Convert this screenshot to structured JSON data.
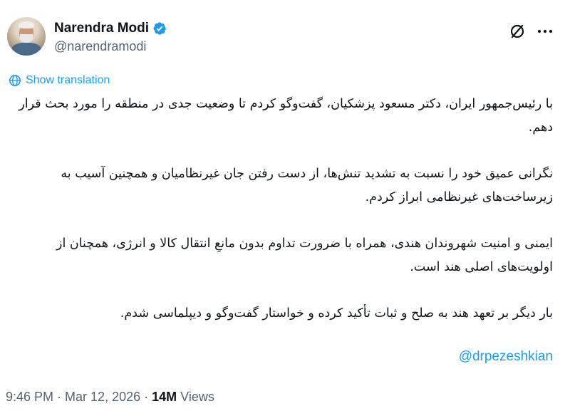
{
  "author": {
    "display_name": "Narendra Modi",
    "handle": "@narendramodi",
    "verified": true
  },
  "header_icons": {
    "grok": "grok-icon",
    "more": "more-icon"
  },
  "translation": {
    "label": "Show translation",
    "icon": "translate-icon"
  },
  "tweet": {
    "paragraphs": [
      "با رئیس‌جمهور ایران، دکتر مسعود پزشکیان، گفت‌وگو کردم تا وضعیت جدی در منطقه را مورد بحث قرار دهم.",
      "نگرانی عمیق خود را نسبت به تشدید تنش‌ها، از دست رفتن جان غیرنظامیان و همچنین آسیب به زیرساخت‌های غیرنظامی ابراز کردم.",
      "ایمنی و امنیت شهروندان هندی، همراه با ضرورت تداوم بدون مانعِ انتقال کالا و انرژی، همچنان از اولویت‌های اصلی هند است.",
      "بار دیگر بر تعهد هند به صلح و ثبات تأکید کرده و خواستار گفت‌وگو و دیپلماسی شدم."
    ],
    "mention": "@drpezeshkian"
  },
  "meta": {
    "time": "9:46 PM",
    "separator": " · ",
    "date": "Mar 12, 2026",
    "views_count": "14M",
    "views_label": " Views"
  },
  "colors": {
    "link": "#1d9bf0",
    "secondary_text": "#536471",
    "primary_text": "#0f1419",
    "verified": "#1d9bf0"
  }
}
